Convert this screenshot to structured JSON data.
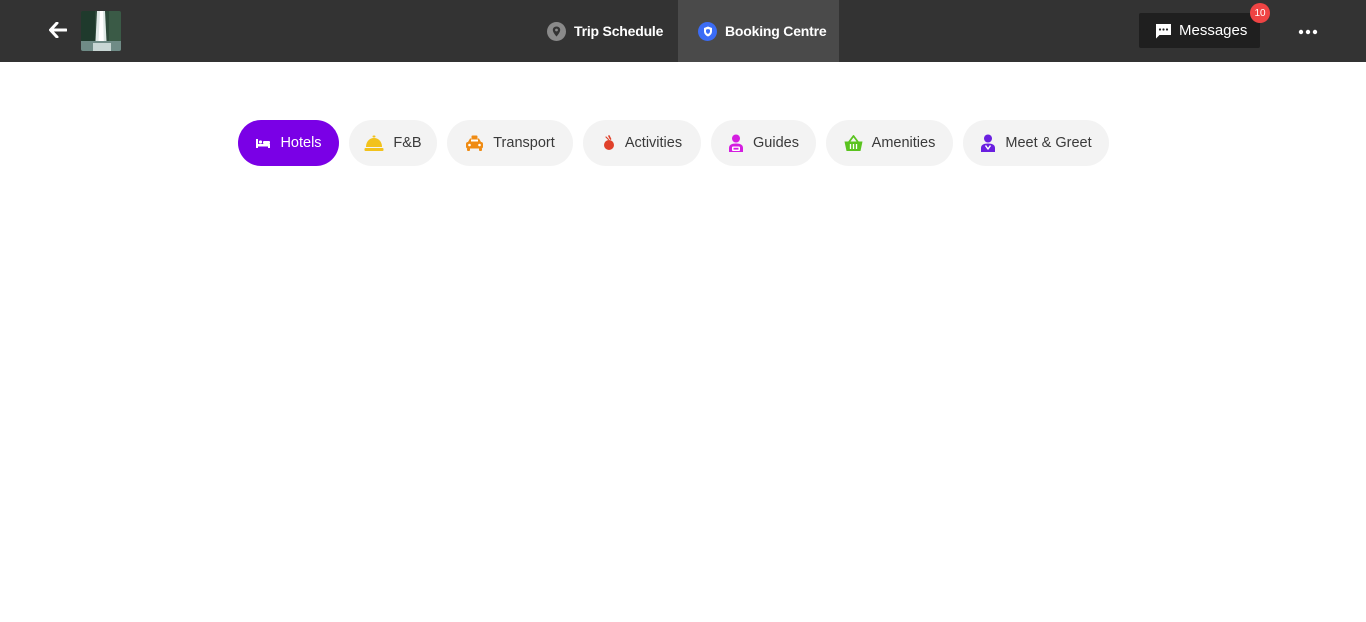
{
  "header": {
    "back_icon": "arrow-left-icon",
    "trip_thumbnail": "waterfall-photo",
    "tabs": [
      {
        "label": "Trip Schedule",
        "icon": "map-pin-icon",
        "icon_color": "#8a8a8a",
        "active": false
      },
      {
        "label": "Booking Centre",
        "icon": "shield-icon",
        "icon_color": "#3b6cf5",
        "active": true
      }
    ],
    "messages": {
      "label": "Messages",
      "icon": "message-icon",
      "badge": "10",
      "badge_color": "#ef4444"
    },
    "more_icon": "more-horizontal-icon"
  },
  "categories": [
    {
      "label": "Hotels",
      "icon": "bed-icon",
      "color": "#ffffff",
      "active": true
    },
    {
      "label": "F&B",
      "icon": "service-bell-icon",
      "color": "#f2c21b",
      "active": false
    },
    {
      "label": "Transport",
      "icon": "taxi-icon",
      "color": "#ef8b13",
      "active": false
    },
    {
      "label": "Activities",
      "icon": "activity-icon",
      "color": "#e0412a",
      "active": false
    },
    {
      "label": "Guides",
      "icon": "guide-icon",
      "color": "#d41ee0",
      "active": false
    },
    {
      "label": "Amenities",
      "icon": "basket-icon",
      "color": "#5ac31f",
      "active": false
    },
    {
      "label": "Meet & Greet",
      "icon": "greeter-icon",
      "color": "#6a1fe0",
      "active": false
    }
  ],
  "colors": {
    "topbar": "#333333",
    "accent": "#7a00e6",
    "chip_bg": "#f3f3f3"
  }
}
